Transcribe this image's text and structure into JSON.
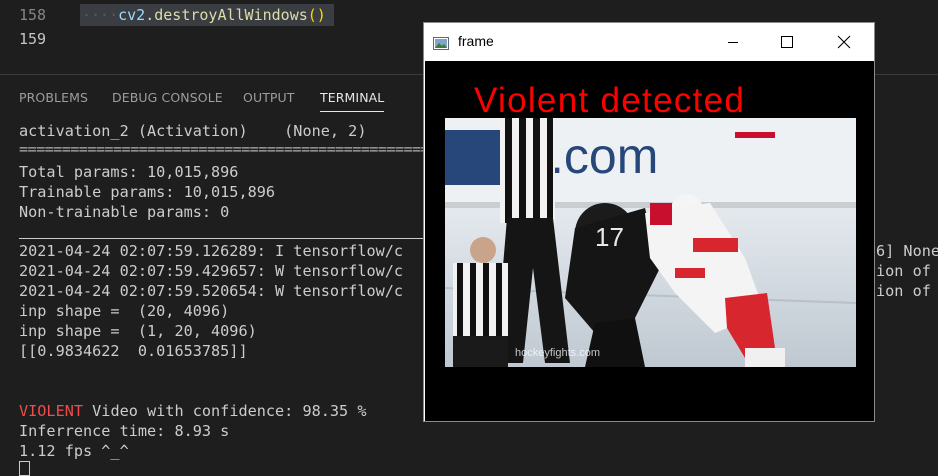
{
  "editor": {
    "lines": [
      {
        "number": "158",
        "indent": "····",
        "obj": "cv2",
        "dot": ".",
        "method": "destroyAllWindows",
        "parens": "()"
      },
      {
        "number": "159"
      }
    ]
  },
  "panel": {
    "tabs": [
      {
        "label": "PROBLEMS",
        "active": false
      },
      {
        "label": "DEBUG CONSOLE",
        "active": false
      },
      {
        "label": "OUTPUT",
        "active": false
      },
      {
        "label": "TERMINAL",
        "active": true
      }
    ]
  },
  "terminal": {
    "lines": [
      "activation_2 (Activation)    (None, 2)",
      "=================================================================",
      "Total params: 10,015,896",
      "Trainable params: 10,015,896",
      "Non-trainable params: 0",
      "",
      "2021-04-24 02:07:59.126289: I tensorflow/c",
      "2021-04-24 02:07:59.429657: W tensorflow/c",
      "2021-04-24 02:07:59.520654: W tensorflow/c",
      "inp shape =  (20, 4096)",
      "inp shape =  (1, 20, 4096)",
      "[[0.9834622  0.01653785]]",
      "",
      "",
      "",
      "Inferrence time: 8.93 s",
      "1.12 fps ^_^"
    ],
    "verdict_label": "VIOLENT",
    "verdict_text": " Video with confidence: 98.35 %",
    "right_fragments": [
      "6] None",
      "ion of",
      "ion of"
    ]
  },
  "cv_window": {
    "title": "frame",
    "overlay_text": "Violent detected",
    "video": {
      "rink_board_text": ".com",
      "watermark": "hockeyfights.com"
    }
  },
  "colors": {
    "terminal_bg": "#1e1e1e",
    "verdict_red": "#f14c4c",
    "overlay_red": "#ff0000",
    "active_tab": "#e7e7e7"
  },
  "icons": [
    "window-app-icon",
    "minimize-icon",
    "maximize-icon",
    "close-icon"
  ]
}
